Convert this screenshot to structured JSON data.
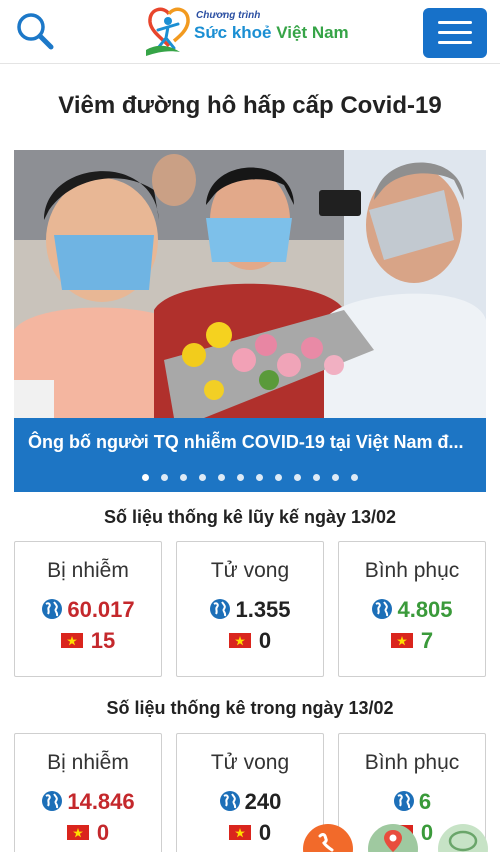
{
  "header": {
    "logo_small": "Chương trình",
    "logo_main_blue": "Sức khoẻ ",
    "logo_main_green": "Việt Nam",
    "search_icon": "search-icon",
    "menu_icon": "hamburger-menu-icon"
  },
  "page": {
    "title": "Viêm đường hô hấp cấp Covid-19"
  },
  "slider": {
    "caption": "Ông bố người TQ nhiễm COVID-19 tại Việt Nam đ...",
    "dot_count": 12,
    "active_dot": 0
  },
  "cumulative": {
    "title": "Số liệu thống kê lũy kế ngày 13/02",
    "infected": {
      "label": "Bị nhiễm",
      "world": "60.017",
      "vietnam": "15"
    },
    "deaths": {
      "label": "Tử vong",
      "world": "1.355",
      "vietnam": "0"
    },
    "recovered": {
      "label": "Bình phục",
      "world": "4.805",
      "vietnam": "7"
    }
  },
  "daily": {
    "title": "Số liệu thống kê trong ngày 13/02",
    "infected": {
      "label": "Bị nhiễm",
      "world": "14.846",
      "vietnam": "0"
    },
    "deaths": {
      "label": "Tử vong",
      "world": "240",
      "vietnam": "0"
    },
    "recovered": {
      "label": "Bình phục",
      "world": "6",
      "vietnam": "0"
    }
  },
  "colors": {
    "brand_blue": "#1771c9",
    "caption_blue": "#1d75c4",
    "infected_red": "#c4282c",
    "recovered_green": "#3a9a3a",
    "phone_orange": "#f26a2a"
  },
  "floating_icons": [
    "phone-icon",
    "map-pin-icon",
    "chat-icon"
  ]
}
